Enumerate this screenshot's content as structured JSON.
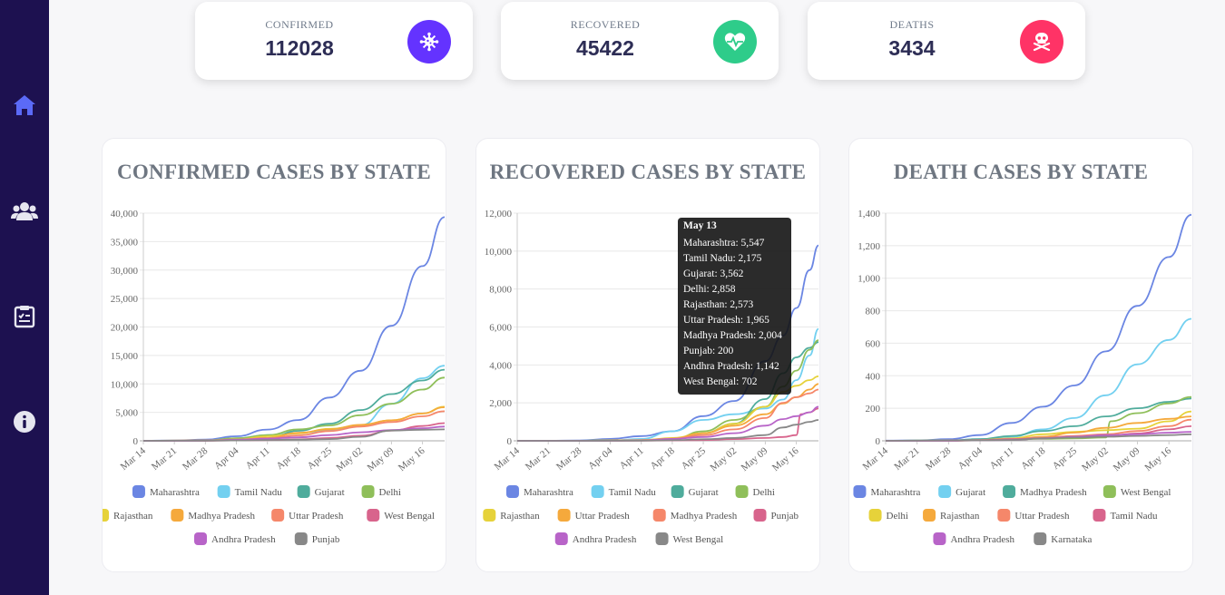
{
  "sidebar": {
    "items": [
      {
        "icon": "home-icon",
        "color": "#5b6af7"
      },
      {
        "icon": "users-icon",
        "color": "#e6e6f0"
      },
      {
        "icon": "clipboard-icon",
        "color": "#e6e6f0"
      },
      {
        "icon": "info-icon",
        "color": "#e6e6f0"
      }
    ]
  },
  "stats": [
    {
      "label": "CONFIRMED",
      "value": "112028",
      "icon": "virus-icon",
      "color": "#6433ff"
    },
    {
      "label": "RECOVERED",
      "value": "45422",
      "icon": "heart-pulse-icon",
      "color": "#2ecc8a"
    },
    {
      "label": "DEATHS",
      "value": "3434",
      "icon": "skull-icon",
      "color": "#ff3366"
    }
  ],
  "tooltip": {
    "title": "May 13",
    "lines": [
      "Maharashtra: 5,547",
      "Tamil Nadu: 2,175",
      "Gujarat: 3,562",
      "Delhi: 2,858",
      "Rajasthan: 2,573",
      "Uttar Pradesh: 1,965",
      "Madhya Pradesh: 2,004",
      "Punjab: 200",
      "Andhra Pradesh: 1,142",
      "West Bengal: 702"
    ]
  },
  "palette": [
    "#6b86e3",
    "#73d0f0",
    "#4fac9c",
    "#8fbf5a",
    "#e6d23a",
    "#f5a93c",
    "#f5876a",
    "#d8648c",
    "#b864c8",
    "#888888"
  ],
  "chart_data": [
    {
      "type": "line",
      "title": "CONFIRMED CASES BY STATE",
      "xticks": [
        "Mar 14",
        "Mar 21",
        "Mar 28",
        "Apr 04",
        "Apr 11",
        "Apr 18",
        "Apr 25",
        "May 02",
        "May 09",
        "May 16"
      ],
      "yticks": [
        "0",
        "5,000",
        "10,000",
        "15,000",
        "20,000",
        "25,000",
        "30,000",
        "35,000",
        "40,000"
      ],
      "ylim": [
        0,
        40000
      ],
      "x_range": [
        "Mar 14",
        "May 21"
      ],
      "legend_position": "bottom",
      "series": [
        {
          "name": "Maharashtra",
          "x": [
            0,
            7,
            14,
            21,
            28,
            35,
            42,
            49,
            56,
            63,
            68
          ],
          "y": [
            20,
            70,
            200,
            800,
            1980,
            3650,
            7600,
            12300,
            20200,
            30700,
            39300
          ]
        },
        {
          "name": "Tamil Nadu",
          "x": [
            0,
            7,
            14,
            21,
            28,
            35,
            42,
            49,
            56,
            63,
            68
          ],
          "y": [
            1,
            10,
            50,
            450,
            1000,
            1380,
            1850,
            2700,
            6500,
            11000,
            13200
          ]
        },
        {
          "name": "Gujarat",
          "x": [
            0,
            7,
            14,
            21,
            28,
            35,
            42,
            49,
            56,
            63,
            68
          ],
          "y": [
            1,
            20,
            60,
            150,
            500,
            1750,
            3000,
            5400,
            8200,
            10600,
            12500
          ]
        },
        {
          "name": "Delhi",
          "x": [
            0,
            7,
            14,
            21,
            28,
            35,
            42,
            49,
            56,
            63,
            68
          ],
          "y": [
            7,
            30,
            50,
            450,
            1000,
            2000,
            2700,
            4500,
            6500,
            9000,
            11100
          ]
        },
        {
          "name": "Rajasthan",
          "x": [
            0,
            7,
            14,
            21,
            28,
            35,
            42,
            49,
            56,
            63,
            68
          ],
          "y": [
            3,
            20,
            60,
            200,
            800,
            1300,
            2100,
            2700,
            3600,
            4800,
            6000
          ]
        },
        {
          "name": "Madhya Pradesh",
          "x": [
            0,
            7,
            14,
            21,
            28,
            35,
            42,
            49,
            56,
            63,
            68
          ],
          "y": [
            0,
            5,
            30,
            150,
            500,
            1400,
            2000,
            2800,
            3600,
            4800,
            5900
          ]
        },
        {
          "name": "Uttar Pradesh",
          "x": [
            0,
            7,
            14,
            21,
            28,
            35,
            42,
            49,
            56,
            63,
            68
          ],
          "y": [
            10,
            25,
            65,
            230,
            450,
            950,
            1700,
            2500,
            3300,
            4300,
            5200
          ]
        },
        {
          "name": "West Bengal",
          "x": [
            0,
            7,
            14,
            21,
            28,
            35,
            42,
            49,
            56,
            63,
            68
          ],
          "y": [
            0,
            5,
            15,
            60,
            120,
            250,
            500,
            900,
            1800,
            2600,
            3100
          ]
        },
        {
          "name": "Andhra Pradesh",
          "x": [
            0,
            7,
            14,
            21,
            28,
            35,
            42,
            49,
            56,
            63,
            68
          ],
          "y": [
            0,
            3,
            20,
            180,
            380,
            600,
            1000,
            1500,
            1900,
            2200,
            2500
          ]
        },
        {
          "name": "Punjab",
          "x": [
            0,
            7,
            14,
            21,
            28,
            35,
            42,
            49,
            56,
            63,
            68
          ],
          "y": [
            1,
            15,
            35,
            60,
            150,
            200,
            300,
            700,
            1800,
            1950,
            2000
          ]
        }
      ]
    },
    {
      "type": "line",
      "title": "RECOVERED CASES BY STATE",
      "xticks": [
        "Mar 14",
        "Mar 21",
        "Mar 28",
        "Apr 04",
        "Apr 11",
        "Apr 18",
        "Apr 25",
        "May 02",
        "May 09",
        "May 16"
      ],
      "yticks": [
        "0",
        "2,000",
        "4,000",
        "6,000",
        "8,000",
        "10,000",
        "12,000"
      ],
      "ylim": [
        0,
        12000
      ],
      "x_range": [
        "Mar 14",
        "May 21"
      ],
      "legend_position": "bottom",
      "series": [
        {
          "name": "Maharashtra",
          "x": [
            0,
            7,
            14,
            21,
            28,
            35,
            42,
            49,
            56,
            60,
            63,
            66,
            68
          ],
          "y": [
            0,
            0,
            20,
            100,
            250,
            500,
            1300,
            2100,
            4200,
            5547,
            7000,
            9000,
            10300
          ]
        },
        {
          "name": "Tamil Nadu",
          "x": [
            0,
            7,
            14,
            21,
            28,
            35,
            42,
            49,
            56,
            60,
            63,
            66,
            68
          ],
          "y": [
            0,
            0,
            5,
            20,
            100,
            500,
            1100,
            1400,
            1700,
            2175,
            3200,
            4500,
            5900
          ]
        },
        {
          "name": "Gujarat",
          "x": [
            0,
            7,
            14,
            21,
            28,
            35,
            42,
            49,
            56,
            60,
            63,
            66,
            68
          ],
          "y": [
            0,
            0,
            5,
            15,
            30,
            100,
            400,
            900,
            2200,
            3562,
            4400,
            4900,
            5200
          ]
        },
        {
          "name": "Delhi",
          "x": [
            0,
            7,
            14,
            21,
            28,
            35,
            42,
            49,
            56,
            60,
            63,
            66,
            68
          ],
          "y": [
            0,
            0,
            5,
            20,
            30,
            80,
            500,
            1100,
            1800,
            2858,
            3700,
            4800,
            5300
          ]
        },
        {
          "name": "Rajasthan",
          "x": [
            0,
            7,
            14,
            21,
            28,
            35,
            42,
            49,
            56,
            60,
            63,
            66,
            68
          ],
          "y": [
            0,
            0,
            5,
            20,
            30,
            150,
            400,
            900,
            1800,
            2573,
            2900,
            3200,
            3400
          ]
        },
        {
          "name": "Uttar Pradesh",
          "x": [
            0,
            7,
            14,
            21,
            28,
            35,
            42,
            49,
            56,
            60,
            63,
            66,
            68
          ],
          "y": [
            0,
            0,
            5,
            20,
            40,
            120,
            400,
            800,
            1400,
            1965,
            2300,
            2700,
            3000
          ]
        },
        {
          "name": "Madhya Pradesh",
          "x": [
            0,
            7,
            14,
            21,
            28,
            35,
            42,
            49,
            56,
            60,
            63,
            66,
            68
          ],
          "y": [
            0,
            0,
            0,
            5,
            20,
            100,
            300,
            600,
            1200,
            2004,
            2300,
            2500,
            2700
          ]
        },
        {
          "name": "Punjab",
          "x": [
            0,
            7,
            14,
            21,
            28,
            35,
            42,
            49,
            56,
            60,
            63,
            64,
            66,
            68
          ],
          "y": [
            0,
            0,
            1,
            5,
            10,
            20,
            40,
            90,
            150,
            200,
            300,
            1400,
            1500,
            1700
          ]
        },
        {
          "name": "Andhra Pradesh",
          "x": [
            0,
            7,
            14,
            21,
            28,
            35,
            42,
            49,
            56,
            60,
            63,
            66,
            68
          ],
          "y": [
            0,
            0,
            0,
            5,
            20,
            100,
            200,
            400,
            800,
            1142,
            1300,
            1500,
            1800
          ]
        },
        {
          "name": "West Bengal",
          "x": [
            0,
            7,
            14,
            21,
            28,
            35,
            42,
            49,
            56,
            60,
            63,
            66,
            68
          ],
          "y": [
            0,
            0,
            0,
            3,
            10,
            30,
            80,
            150,
            300,
            702,
            850,
            1000,
            1100
          ]
        }
      ]
    },
    {
      "type": "line",
      "title": "DEATH CASES BY STATE",
      "xticks": [
        "Mar 14",
        "Mar 21",
        "Mar 28",
        "Apr 04",
        "Apr 11",
        "Apr 18",
        "Apr 25",
        "May 02",
        "May 09",
        "May 16"
      ],
      "yticks": [
        "0",
        "200",
        "400",
        "600",
        "800",
        "1,000",
        "1,200",
        "1,400"
      ],
      "ylim": [
        0,
        1400
      ],
      "x_range": [
        "Mar 14",
        "May 21"
      ],
      "legend_position": "bottom",
      "series": [
        {
          "name": "Maharashtra",
          "x": [
            0,
            7,
            14,
            21,
            28,
            35,
            42,
            49,
            56,
            63,
            68
          ],
          "y": [
            1,
            3,
            10,
            35,
            110,
            210,
            340,
            550,
            830,
            1130,
            1390
          ]
        },
        {
          "name": "Gujarat",
          "x": [
            0,
            7,
            14,
            21,
            28,
            35,
            42,
            49,
            56,
            63,
            68
          ],
          "y": [
            0,
            1,
            3,
            10,
            25,
            70,
            140,
            280,
            470,
            620,
            750
          ]
        },
        {
          "name": "Madhya Pradesh",
          "x": [
            0,
            7,
            14,
            21,
            28,
            35,
            42,
            49,
            56,
            63,
            68
          ],
          "y": [
            0,
            1,
            2,
            10,
            30,
            60,
            90,
            150,
            200,
            240,
            260
          ]
        },
        {
          "name": "West Bengal",
          "x": [
            0,
            7,
            14,
            21,
            28,
            35,
            42,
            49,
            50,
            56,
            63,
            68
          ],
          "y": [
            0,
            0,
            1,
            3,
            7,
            12,
            15,
            20,
            120,
            170,
            230,
            270
          ]
        },
        {
          "name": "Delhi",
          "x": [
            0,
            7,
            14,
            21,
            28,
            35,
            42,
            49,
            56,
            63,
            68
          ],
          "y": [
            0,
            1,
            2,
            5,
            15,
            40,
            55,
            65,
            75,
            120,
            180
          ]
        },
        {
          "name": "Rajasthan",
          "x": [
            0,
            7,
            14,
            21,
            28,
            35,
            42,
            49,
            56,
            63,
            68
          ],
          "y": [
            0,
            0,
            0,
            3,
            10,
            25,
            50,
            80,
            110,
            135,
            150
          ]
        },
        {
          "name": "Uttar Pradesh",
          "x": [
            0,
            7,
            14,
            21,
            28,
            35,
            42,
            49,
            56,
            63,
            68
          ],
          "y": [
            0,
            0,
            1,
            3,
            10,
            20,
            30,
            40,
            60,
            90,
            130
          ]
        },
        {
          "name": "Tamil Nadu",
          "x": [
            0,
            7,
            14,
            21,
            28,
            35,
            42,
            49,
            56,
            63,
            68
          ],
          "y": [
            0,
            0,
            1,
            5,
            10,
            15,
            25,
            30,
            45,
            70,
            90
          ]
        },
        {
          "name": "Andhra Pradesh",
          "x": [
            0,
            7,
            14,
            21,
            28,
            35,
            42,
            49,
            56,
            63,
            68
          ],
          "y": [
            0,
            0,
            0,
            3,
            5,
            15,
            25,
            35,
            40,
            50,
            55
          ]
        },
        {
          "name": "Karnataka",
          "x": [
            0,
            7,
            14,
            21,
            28,
            35,
            42,
            49,
            56,
            63,
            68
          ],
          "y": [
            0,
            1,
            2,
            3,
            5,
            15,
            20,
            25,
            30,
            35,
            40
          ]
        }
      ]
    }
  ]
}
